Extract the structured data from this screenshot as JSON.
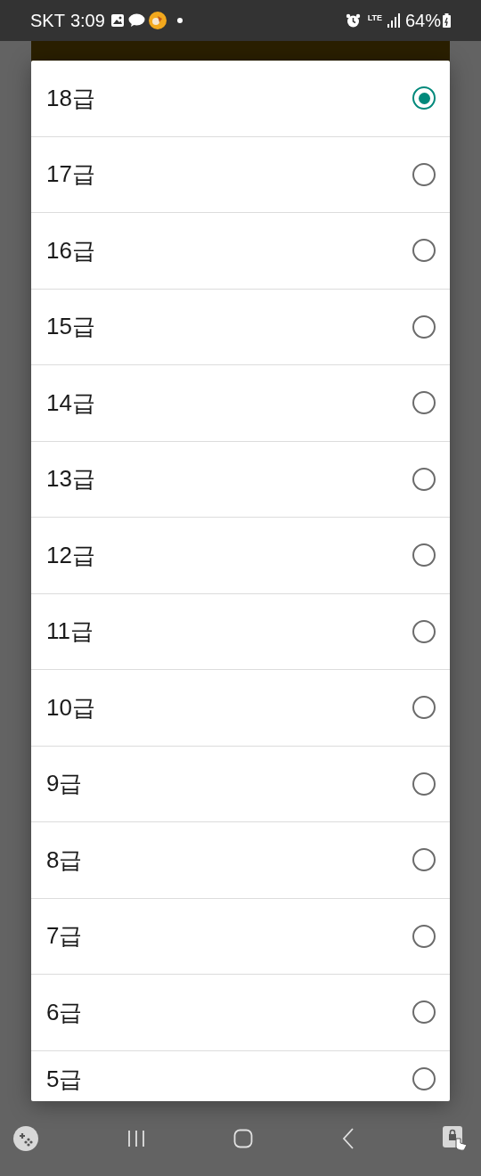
{
  "status_bar": {
    "carrier": "SKT",
    "time": "3:09",
    "network": "LTE",
    "battery": "64%"
  },
  "options": [
    {
      "label": "18급",
      "selected": true
    },
    {
      "label": "17급",
      "selected": false
    },
    {
      "label": "16급",
      "selected": false
    },
    {
      "label": "15급",
      "selected": false
    },
    {
      "label": "14급",
      "selected": false
    },
    {
      "label": "13급",
      "selected": false
    },
    {
      "label": "12급",
      "selected": false
    },
    {
      "label": "11급",
      "selected": false
    },
    {
      "label": "10급",
      "selected": false
    },
    {
      "label": "9급",
      "selected": false
    },
    {
      "label": "8급",
      "selected": false
    },
    {
      "label": "7급",
      "selected": false
    },
    {
      "label": "6급",
      "selected": false
    },
    {
      "label": "5급",
      "selected": false
    }
  ]
}
